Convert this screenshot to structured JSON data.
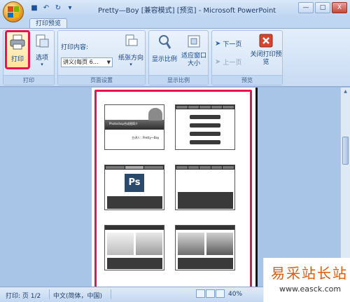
{
  "window": {
    "title": "Pretty—Boy [兼容模式] [预览] - Microsoft PowerPoint",
    "minimize": "—",
    "maximize": "□",
    "close": "X"
  },
  "tabs": [
    "打印预览"
  ],
  "ribbon": {
    "print_group": {
      "print_label": "打印",
      "options_label": "选项",
      "group_label": "打印"
    },
    "page_setup_group": {
      "print_what_label": "打印内容:",
      "print_what_value": "讲义(每页 6...",
      "orientation_label": "纸张方向",
      "group_label": "页面设置"
    },
    "zoom_group": {
      "zoom_label": "显示比例",
      "fit_window_label": "适应窗口大小",
      "group_label": "显示比例"
    },
    "preview_group": {
      "next_page_label": "下一页",
      "prev_page_label": "上一页",
      "close_preview_label": "关闭打印预览",
      "group_label": "预览"
    }
  },
  "slides": {
    "slide1_title": "Photoshop合成图简介",
    "slide1_author": "主讲人：Pretty—Boy",
    "slide3_logo": "Ps"
  },
  "status": {
    "page": "打印: 页 1/2",
    "language": "中文(简体，中国)",
    "zoom": "40%"
  },
  "watermark": {
    "title": "易采站长站",
    "url": "www.easck.com"
  }
}
